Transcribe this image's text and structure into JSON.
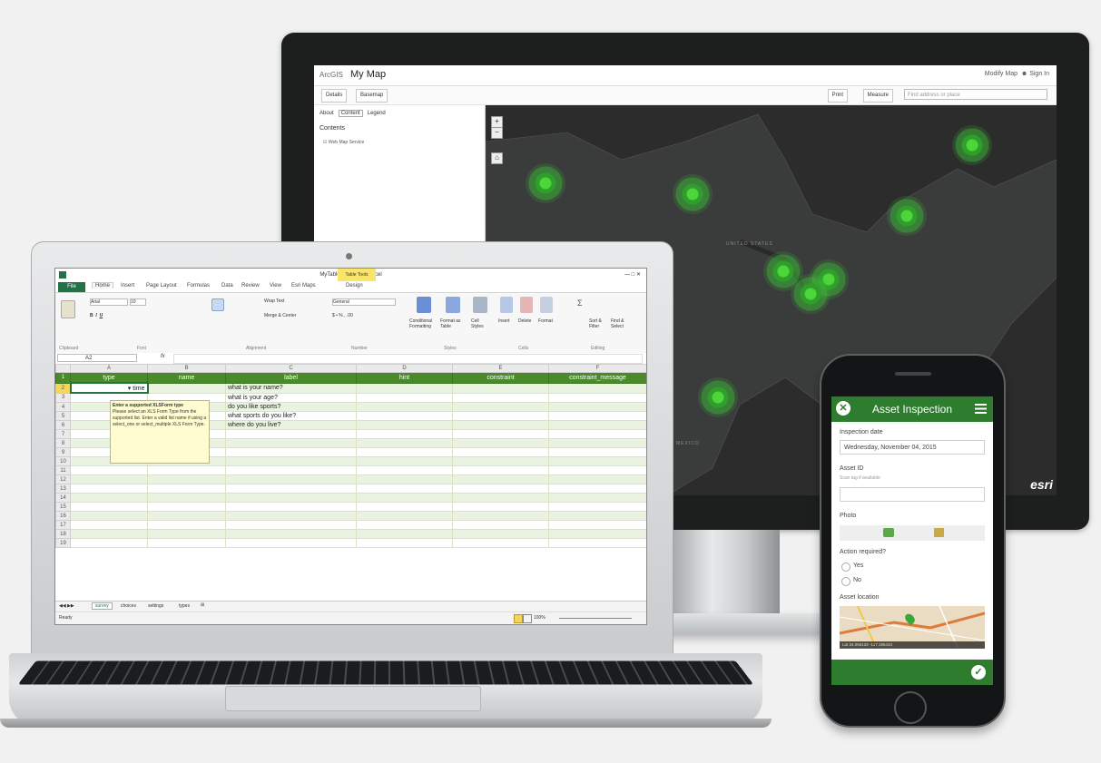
{
  "monitor": {
    "brand": "ArcGIS",
    "map_title": "My Map",
    "user_link": "Modify Map",
    "sign_in": "Sign In",
    "details_btn": "Details",
    "basemap_btn": "Basemap",
    "print_btn": "Print",
    "measure_btn": "Measure",
    "search_placeholder": "Find address or place",
    "side_tabs": [
      "About",
      "Content",
      "Legend"
    ],
    "contents_heading": "Contents",
    "layer_name": "Web Map Service",
    "esri_logo": "esri",
    "map_labels": {
      "country1": "UNITED STATES",
      "country2": "MEXICO"
    }
  },
  "excel": {
    "window_title": "MyTable - Microsoft Excel",
    "table_tools": "Table Tools",
    "tabs": [
      "File",
      "Home",
      "Insert",
      "Page Layout",
      "Formulas",
      "Data",
      "Review",
      "View",
      "Esri Maps",
      "Design"
    ],
    "font_name": "Arial",
    "font_size": "10",
    "number_format": "General",
    "wrap_text": "Wrap Text",
    "merge_center": "Merge & Center",
    "ribbon_groups": [
      "Clipboard",
      "Font",
      "Alignment",
      "Number",
      "Styles",
      "Cells",
      "Editing"
    ],
    "styles_buttons": [
      "Conditional Formatting",
      "Format as Table",
      "Cell Styles"
    ],
    "cells_buttons": [
      "Insert",
      "Delete",
      "Format"
    ],
    "editing_buttons": [
      "Sort & Filter",
      "Find & Select"
    ],
    "name_box": "A2",
    "fx": "fx",
    "columns": [
      "A",
      "B",
      "C",
      "D",
      "E",
      "F"
    ],
    "headers": [
      "type",
      "name",
      "label",
      "hint",
      "constraint",
      "constraint_message"
    ],
    "rows": [
      [
        "",
        "",
        "what is your name?",
        "",
        "",
        ""
      ],
      [
        "",
        "",
        "what is your age?",
        "",
        "",
        ""
      ],
      [
        "",
        "",
        "do you like sports?",
        "",
        "",
        ""
      ],
      [
        "",
        "",
        "what sports do you like?",
        "",
        "",
        ""
      ],
      [
        "",
        "",
        "where do you live?",
        "",
        "",
        ""
      ]
    ],
    "a2_value": "time",
    "tooltip_title": "Enter a supported XLSForm type",
    "tooltip_body": "Please select an XLS Form Type from the supported list. Enter a valid list name if using a select_one or select_multiple XLS Form Type.",
    "sheet_tabs": [
      "survey",
      "choices",
      "settings",
      "types"
    ],
    "status": "Ready",
    "zoom": "100%"
  },
  "phone": {
    "title": "Asset Inspection",
    "inspection_date_label": "Inspection date",
    "inspection_date_value": "Wednesday, November 04, 2015",
    "asset_id_label": "Asset ID",
    "asset_id_hint": "Scan tag if available",
    "photo_label": "Photo",
    "action_label": "Action required?",
    "option_yes": "Yes",
    "option_no": "No",
    "location_label": "Asset location",
    "coords": "Lat 34.056128 -117.195434"
  },
  "colors": {
    "green": "#2e7d2f",
    "excel_green": "#217346",
    "cluster": "#4cd63c"
  }
}
